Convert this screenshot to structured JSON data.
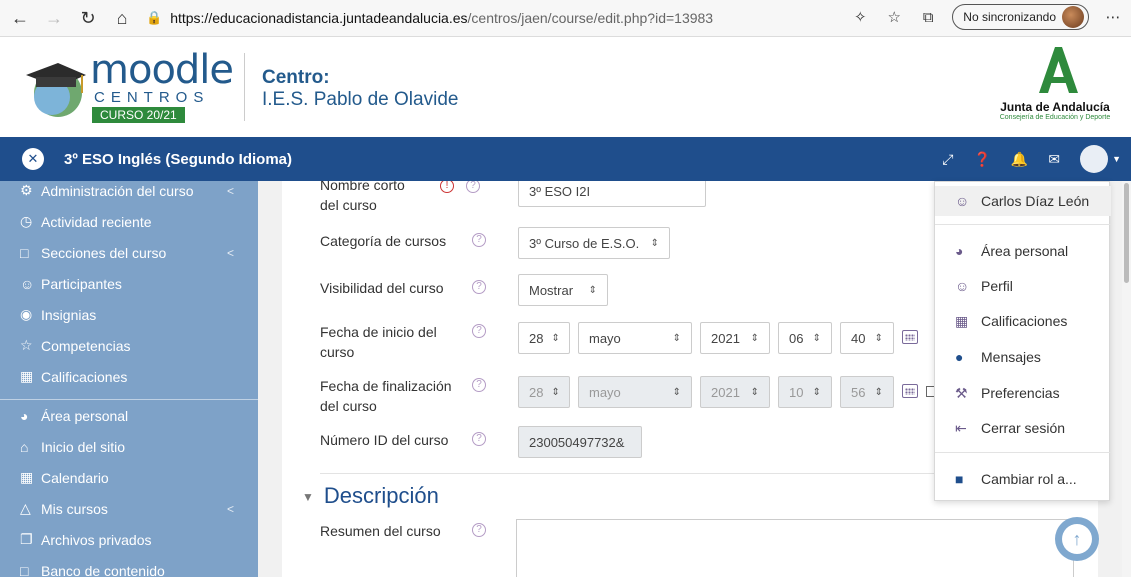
{
  "browser": {
    "url_domain": "https://educacionadistancia.juntadeandalucia.es",
    "url_path": "/centros/jaen/course/edit.php?id=13983",
    "sync_label": "No sincronizando"
  },
  "header": {
    "logo_word": "moodle",
    "logo_sub": "CENTROS",
    "logo_badge": "CURSO 20/21",
    "centro_label": "Centro:",
    "centro_name": "I.E.S. Pablo de Olavide",
    "junta_title": "Junta de Andalucía",
    "junta_sub": "Consejería de Educación y Deporte"
  },
  "navbar": {
    "course_title": "3º ESO Inglés (Segundo Idioma)"
  },
  "sidebar": {
    "items": [
      {
        "label": "Administración del curso",
        "icon": "gear-icon",
        "chev": true
      },
      {
        "label": "Actividad reciente",
        "icon": "clock-icon"
      },
      {
        "label": "Secciones del curso",
        "icon": "folder-icon",
        "chev": true
      },
      {
        "label": "Participantes",
        "icon": "users-icon"
      },
      {
        "label": "Insignias",
        "icon": "badge-icon"
      },
      {
        "label": "Competencias",
        "icon": "star-icon"
      },
      {
        "label": "Calificaciones",
        "icon": "table-icon"
      },
      {
        "label": "Área personal",
        "icon": "dashboard-icon"
      },
      {
        "label": "Inicio del sitio",
        "icon": "home-icon"
      },
      {
        "label": "Calendario",
        "icon": "calendar-icon"
      },
      {
        "label": "Mis cursos",
        "icon": "graduation-icon",
        "chev": true
      },
      {
        "label": "Archivos privados",
        "icon": "files-icon"
      },
      {
        "label": "Banco de contenido",
        "icon": "folder-icon"
      }
    ]
  },
  "form": {
    "shortname_label": "Nombre corto del curso",
    "shortname_value": "3º ESO I2I",
    "category_label": "Categoría de cursos",
    "category_value": "3º Curso de E.S.O.",
    "visibility_label": "Visibilidad del curso",
    "visibility_value": "Mostrar",
    "startdate_label": "Fecha de inicio del curso",
    "start": {
      "day": "28",
      "month": "mayo",
      "year": "2021",
      "hour": "06",
      "minute": "40"
    },
    "enddate_label": "Fecha de finalización del curso",
    "end": {
      "day": "28",
      "month": "mayo",
      "year": "2021",
      "hour": "10",
      "minute": "56"
    },
    "idnumber_label": "Número ID del curso",
    "idnumber_value": "230050497732&",
    "description_heading": "Descripción",
    "summary_label": "Resumen del curso"
  },
  "user_menu": {
    "name": "Carlos Díaz León",
    "items": [
      "Área personal",
      "Perfil",
      "Calificaciones",
      "Mensajes",
      "Preferencias",
      "Cerrar sesión"
    ],
    "switch_role": "Cambiar rol a..."
  }
}
